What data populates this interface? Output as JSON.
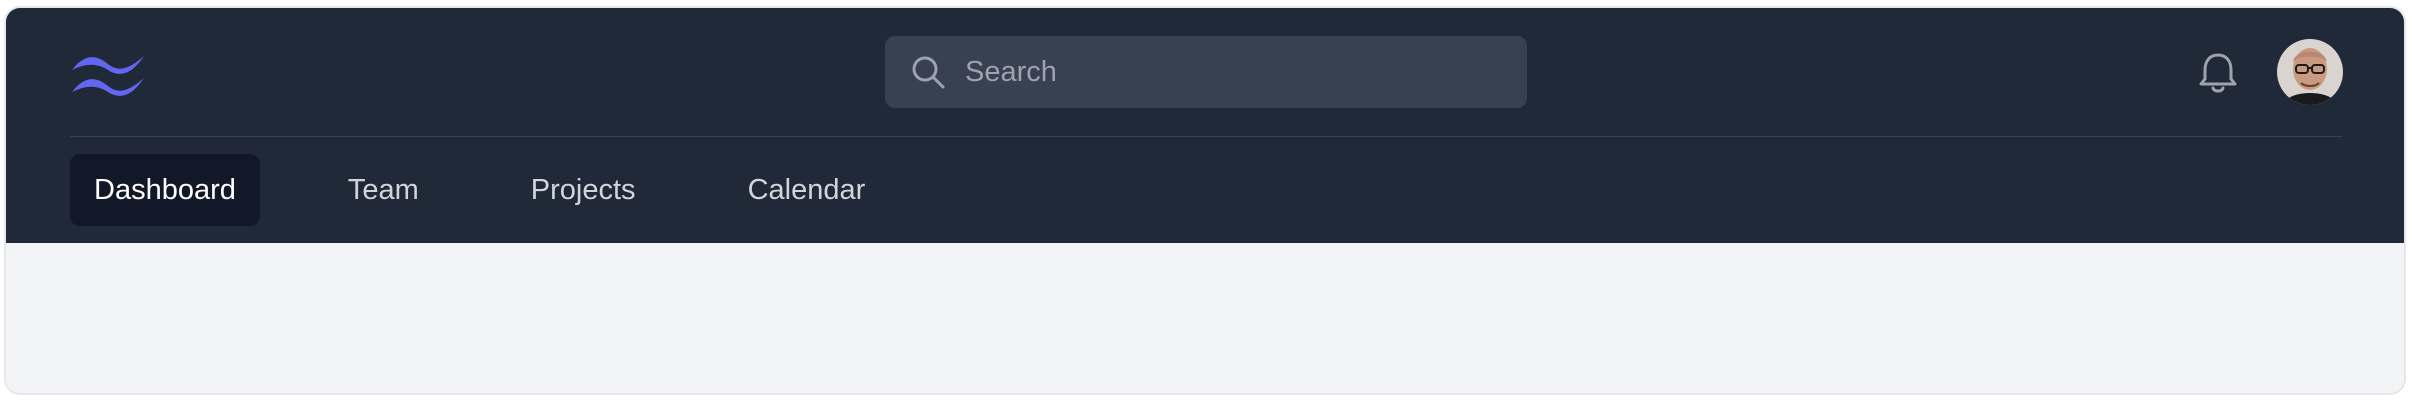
{
  "brand": {
    "logo_icon": "tailwind-waves-logo",
    "accent_color": "#6366f1"
  },
  "search": {
    "placeholder": "Search",
    "value": "",
    "icon": "search-icon"
  },
  "header_actions": {
    "notifications_icon": "bell-icon",
    "avatar_icon": "user-avatar"
  },
  "tabs": [
    {
      "label": "Dashboard",
      "active": true
    },
    {
      "label": "Team",
      "active": false
    },
    {
      "label": "Projects",
      "active": false
    },
    {
      "label": "Calendar",
      "active": false
    }
  ],
  "colors": {
    "navbar_bg": "#1f2937",
    "active_tab_bg": "#111827",
    "search_bg": "#374151",
    "page_bg": "#f3f4f6"
  }
}
